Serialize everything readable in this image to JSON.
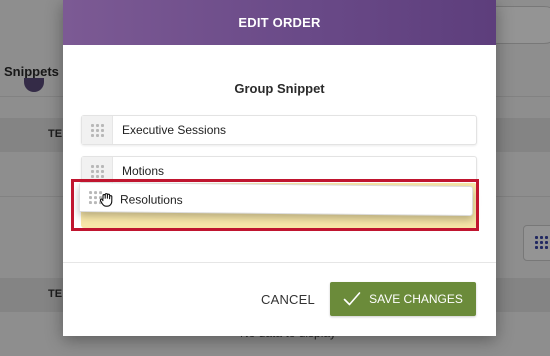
{
  "background": {
    "sidebar_label": "Snippets",
    "column_header_top": "TE",
    "column_header_bottom": "TE",
    "empty_message": "No data to display"
  },
  "modal": {
    "title": "EDIT ORDER",
    "group_title": "Group Snippet",
    "items": [
      {
        "label": "Executive Sessions"
      },
      {
        "label": "Motions"
      },
      {
        "label": "Resolutions"
      }
    ],
    "cancel_label": "CANCEL",
    "save_label": "SAVE CHANGES"
  },
  "colors": {
    "header": "#6a4a88",
    "save_button": "#6b8b3a",
    "drop_placeholder": "#f7e6a8",
    "highlight": "#c0152f"
  },
  "icons": {
    "drag": "grip-dots-icon",
    "cursor": "grab-hand-icon",
    "confirm": "check-icon",
    "view": "grid-dots-icon"
  }
}
